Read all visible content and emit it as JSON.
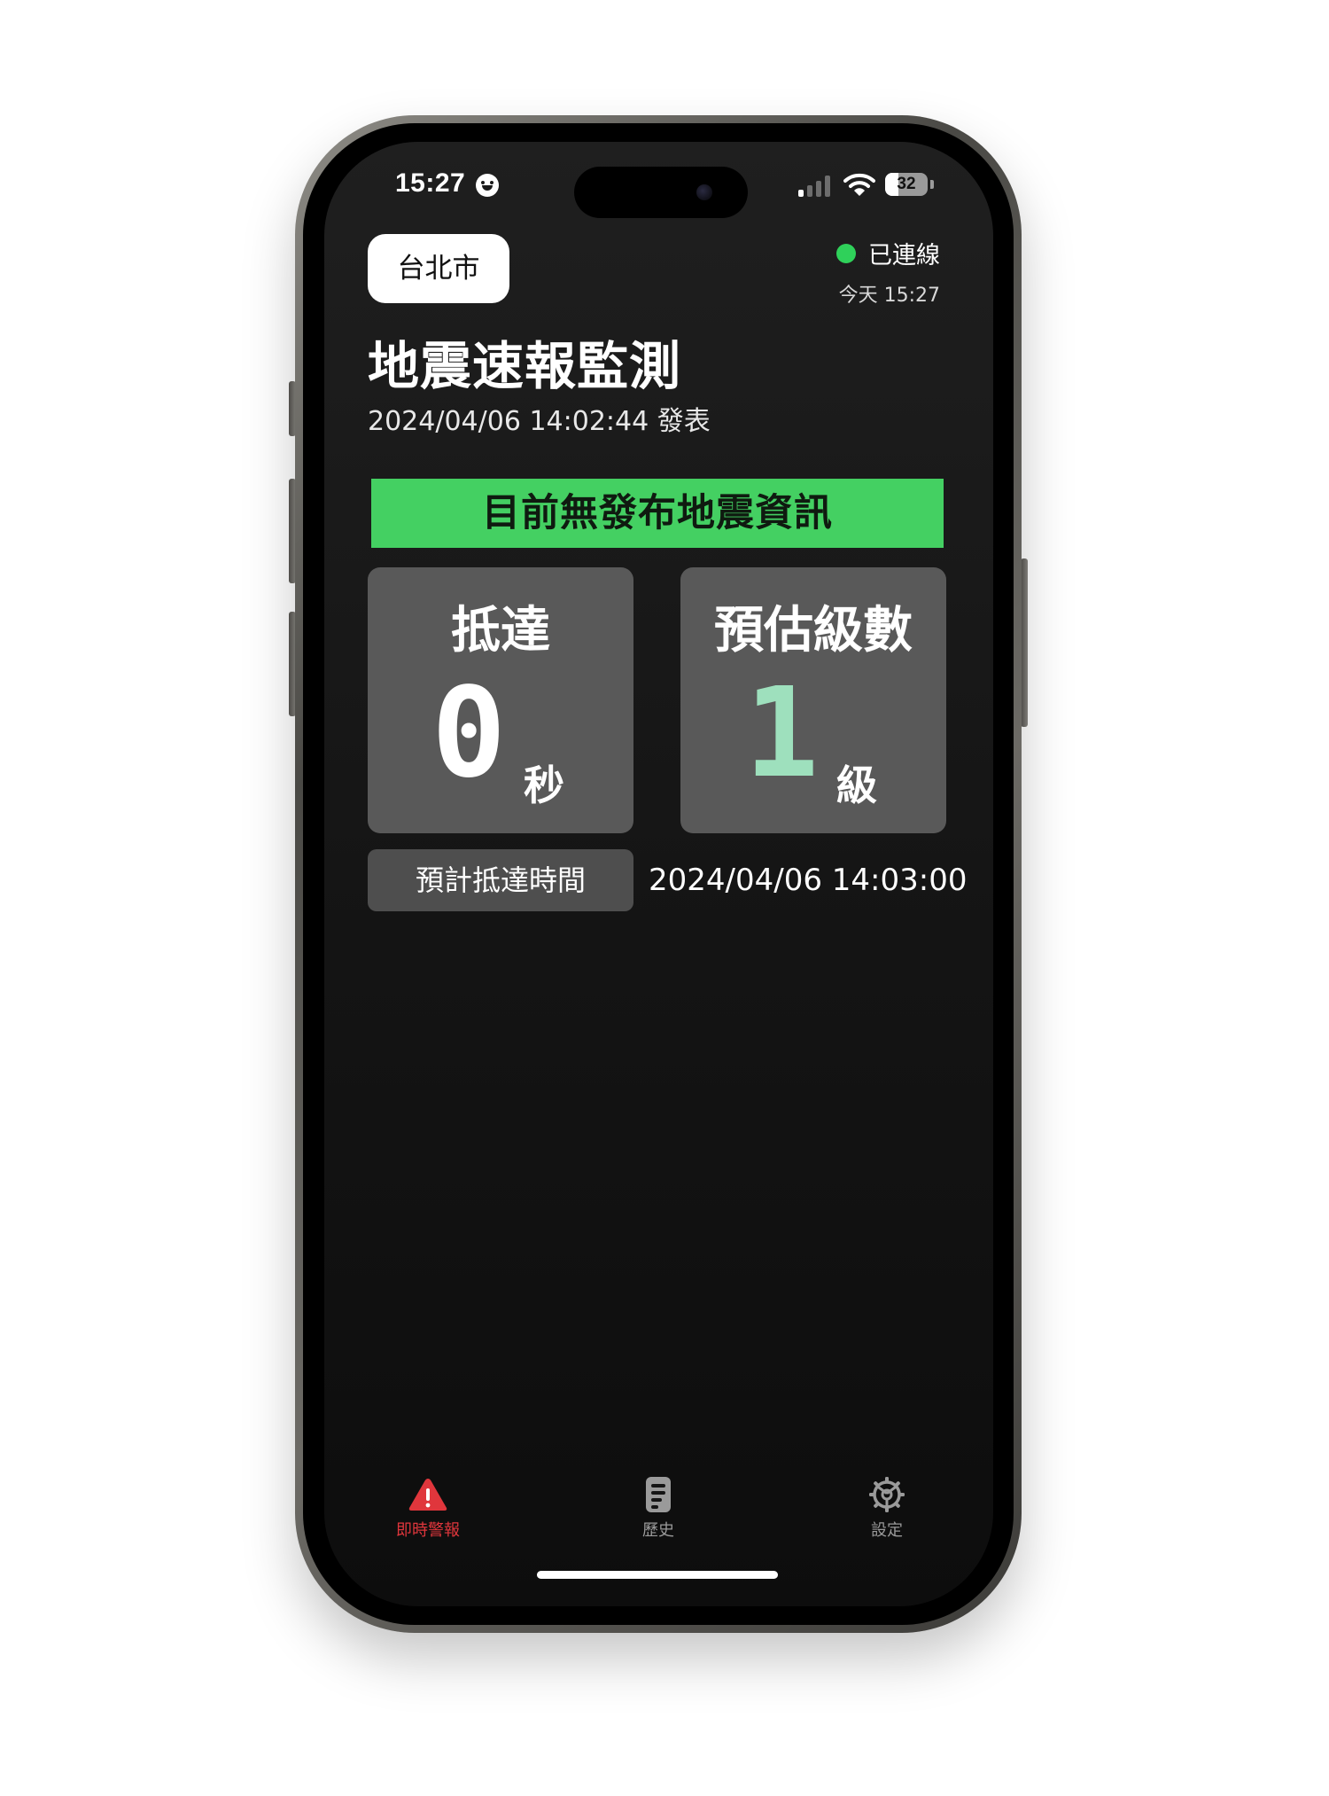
{
  "status_bar": {
    "time": "15:27",
    "battery": "32",
    "battery_level_percent": 32,
    "focus_icon": "smiley-focus-icon",
    "signal_icon": "cellular-signal-icon",
    "wifi_icon": "wifi-icon"
  },
  "header": {
    "location": "台北市",
    "connection_status": "已連線",
    "connection_time": "今天 15:27",
    "connection_color": "#2fd15a"
  },
  "main": {
    "title": "地震速報監測",
    "publish_time": "2024/04/06 14:02:44 發表",
    "banner": {
      "text": "目前無發布地震資訊",
      "color": "#44d062"
    },
    "cards": [
      {
        "label": "抵達",
        "value": "0",
        "unit": "秒",
        "value_color": "#ffffff"
      },
      {
        "label": "預估級數",
        "value": "1",
        "unit": "級",
        "value_color": "#9ee0bd"
      }
    ],
    "eta": {
      "label": "預計抵達時間",
      "value": "2024/04/06 14:03:00"
    }
  },
  "tab_bar": {
    "tabs": [
      {
        "label": "即時警報",
        "icon": "warning-triangle-icon",
        "active": true,
        "color": "#e0363c"
      },
      {
        "label": "歷史",
        "icon": "document-icon",
        "active": false,
        "color": "#9a9a9a"
      },
      {
        "label": "設定",
        "icon": "gear-icon",
        "active": false,
        "color": "#9a9a9a"
      }
    ]
  }
}
